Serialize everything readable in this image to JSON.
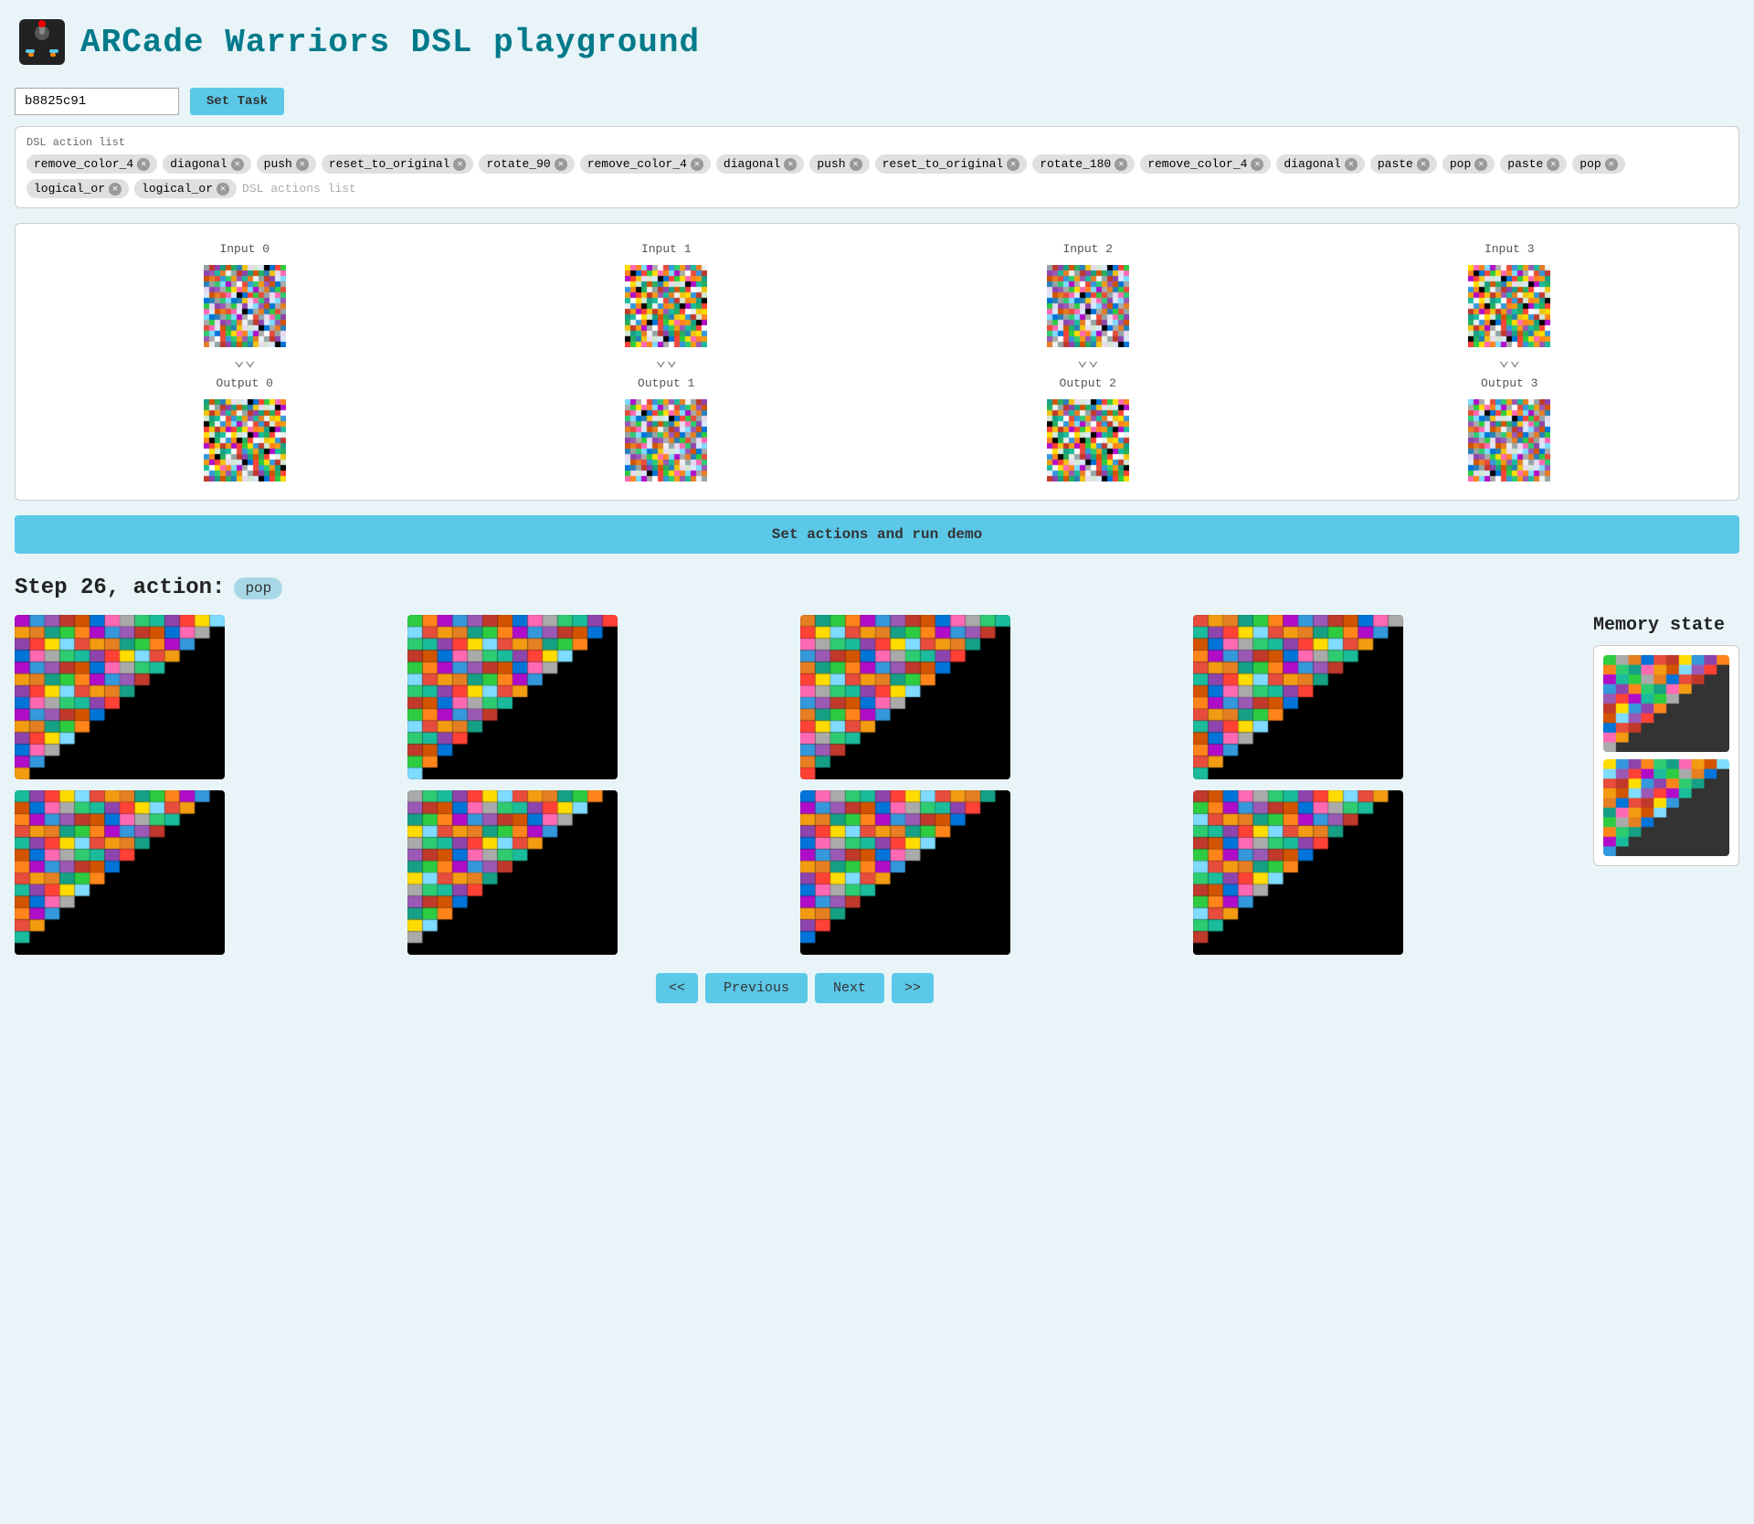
{
  "header": {
    "title": "ARCade Warriors DSL playground",
    "logo_alt": "joystick-icon"
  },
  "task": {
    "input_value": "b8825c91",
    "input_placeholder": "task id",
    "set_task_label": "Set Task"
  },
  "dsl": {
    "label": "DSL action list",
    "tags": [
      "remove_color_4",
      "diagonal",
      "push",
      "reset_to_original",
      "rotate_90",
      "remove_color_4",
      "diagonal",
      "push",
      "reset_to_original",
      "rotate_180",
      "remove_color_4",
      "diagonal",
      "paste",
      "pop",
      "paste",
      "pop",
      "logical_or",
      "logical_or"
    ],
    "placeholder": "DSL actions list"
  },
  "examples": {
    "pairs": [
      {
        "input_label": "Input 0",
        "output_label": "Output 0"
      },
      {
        "input_label": "Input 1",
        "output_label": "Output 1"
      },
      {
        "input_label": "Input 2",
        "output_label": "Output 2"
      },
      {
        "input_label": "Input 3",
        "output_label": "Output 3"
      }
    ]
  },
  "run_demo": {
    "label": "Set actions and run demo"
  },
  "step": {
    "label": "Step 26, action:",
    "action": "pop"
  },
  "memory_state": {
    "label": "Memory state"
  },
  "navigation": {
    "prev_prev": "<<",
    "prev": "Previous",
    "next": "Next",
    "next_next": ">>"
  },
  "colors": {
    "accent": "#5bc8e8",
    "bg": "#e8f4f8"
  }
}
